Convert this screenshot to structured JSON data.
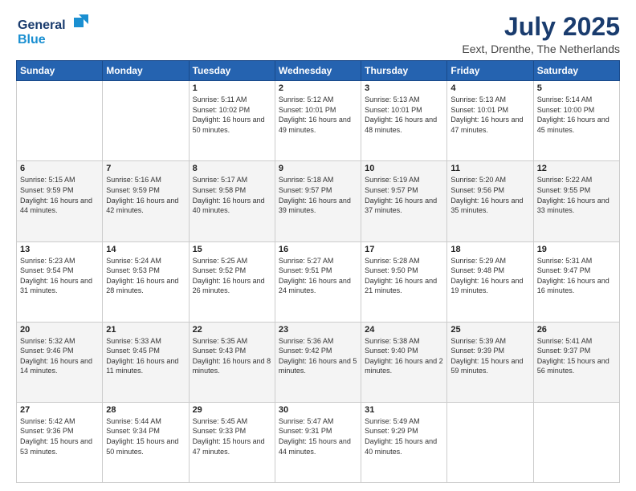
{
  "logo": {
    "line1": "General",
    "line2": "Blue"
  },
  "header": {
    "month": "July 2025",
    "location": "Eext, Drenthe, The Netherlands"
  },
  "weekdays": [
    "Sunday",
    "Monday",
    "Tuesday",
    "Wednesday",
    "Thursday",
    "Friday",
    "Saturday"
  ],
  "weeks": [
    [
      {
        "day": "",
        "sunrise": "",
        "sunset": "",
        "daylight": ""
      },
      {
        "day": "",
        "sunrise": "",
        "sunset": "",
        "daylight": ""
      },
      {
        "day": "1",
        "sunrise": "Sunrise: 5:11 AM",
        "sunset": "Sunset: 10:02 PM",
        "daylight": "Daylight: 16 hours and 50 minutes."
      },
      {
        "day": "2",
        "sunrise": "Sunrise: 5:12 AM",
        "sunset": "Sunset: 10:01 PM",
        "daylight": "Daylight: 16 hours and 49 minutes."
      },
      {
        "day": "3",
        "sunrise": "Sunrise: 5:13 AM",
        "sunset": "Sunset: 10:01 PM",
        "daylight": "Daylight: 16 hours and 48 minutes."
      },
      {
        "day": "4",
        "sunrise": "Sunrise: 5:13 AM",
        "sunset": "Sunset: 10:01 PM",
        "daylight": "Daylight: 16 hours and 47 minutes."
      },
      {
        "day": "5",
        "sunrise": "Sunrise: 5:14 AM",
        "sunset": "Sunset: 10:00 PM",
        "daylight": "Daylight: 16 hours and 45 minutes."
      }
    ],
    [
      {
        "day": "6",
        "sunrise": "Sunrise: 5:15 AM",
        "sunset": "Sunset: 9:59 PM",
        "daylight": "Daylight: 16 hours and 44 minutes."
      },
      {
        "day": "7",
        "sunrise": "Sunrise: 5:16 AM",
        "sunset": "Sunset: 9:59 PM",
        "daylight": "Daylight: 16 hours and 42 minutes."
      },
      {
        "day": "8",
        "sunrise": "Sunrise: 5:17 AM",
        "sunset": "Sunset: 9:58 PM",
        "daylight": "Daylight: 16 hours and 40 minutes."
      },
      {
        "day": "9",
        "sunrise": "Sunrise: 5:18 AM",
        "sunset": "Sunset: 9:57 PM",
        "daylight": "Daylight: 16 hours and 39 minutes."
      },
      {
        "day": "10",
        "sunrise": "Sunrise: 5:19 AM",
        "sunset": "Sunset: 9:57 PM",
        "daylight": "Daylight: 16 hours and 37 minutes."
      },
      {
        "day": "11",
        "sunrise": "Sunrise: 5:20 AM",
        "sunset": "Sunset: 9:56 PM",
        "daylight": "Daylight: 16 hours and 35 minutes."
      },
      {
        "day": "12",
        "sunrise": "Sunrise: 5:22 AM",
        "sunset": "Sunset: 9:55 PM",
        "daylight": "Daylight: 16 hours and 33 minutes."
      }
    ],
    [
      {
        "day": "13",
        "sunrise": "Sunrise: 5:23 AM",
        "sunset": "Sunset: 9:54 PM",
        "daylight": "Daylight: 16 hours and 31 minutes."
      },
      {
        "day": "14",
        "sunrise": "Sunrise: 5:24 AM",
        "sunset": "Sunset: 9:53 PM",
        "daylight": "Daylight: 16 hours and 28 minutes."
      },
      {
        "day": "15",
        "sunrise": "Sunrise: 5:25 AM",
        "sunset": "Sunset: 9:52 PM",
        "daylight": "Daylight: 16 hours and 26 minutes."
      },
      {
        "day": "16",
        "sunrise": "Sunrise: 5:27 AM",
        "sunset": "Sunset: 9:51 PM",
        "daylight": "Daylight: 16 hours and 24 minutes."
      },
      {
        "day": "17",
        "sunrise": "Sunrise: 5:28 AM",
        "sunset": "Sunset: 9:50 PM",
        "daylight": "Daylight: 16 hours and 21 minutes."
      },
      {
        "day": "18",
        "sunrise": "Sunrise: 5:29 AM",
        "sunset": "Sunset: 9:48 PM",
        "daylight": "Daylight: 16 hours and 19 minutes."
      },
      {
        "day": "19",
        "sunrise": "Sunrise: 5:31 AM",
        "sunset": "Sunset: 9:47 PM",
        "daylight": "Daylight: 16 hours and 16 minutes."
      }
    ],
    [
      {
        "day": "20",
        "sunrise": "Sunrise: 5:32 AM",
        "sunset": "Sunset: 9:46 PM",
        "daylight": "Daylight: 16 hours and 14 minutes."
      },
      {
        "day": "21",
        "sunrise": "Sunrise: 5:33 AM",
        "sunset": "Sunset: 9:45 PM",
        "daylight": "Daylight: 16 hours and 11 minutes."
      },
      {
        "day": "22",
        "sunrise": "Sunrise: 5:35 AM",
        "sunset": "Sunset: 9:43 PM",
        "daylight": "Daylight: 16 hours and 8 minutes."
      },
      {
        "day": "23",
        "sunrise": "Sunrise: 5:36 AM",
        "sunset": "Sunset: 9:42 PM",
        "daylight": "Daylight: 16 hours and 5 minutes."
      },
      {
        "day": "24",
        "sunrise": "Sunrise: 5:38 AM",
        "sunset": "Sunset: 9:40 PM",
        "daylight": "Daylight: 16 hours and 2 minutes."
      },
      {
        "day": "25",
        "sunrise": "Sunrise: 5:39 AM",
        "sunset": "Sunset: 9:39 PM",
        "daylight": "Daylight: 15 hours and 59 minutes."
      },
      {
        "day": "26",
        "sunrise": "Sunrise: 5:41 AM",
        "sunset": "Sunset: 9:37 PM",
        "daylight": "Daylight: 15 hours and 56 minutes."
      }
    ],
    [
      {
        "day": "27",
        "sunrise": "Sunrise: 5:42 AM",
        "sunset": "Sunset: 9:36 PM",
        "daylight": "Daylight: 15 hours and 53 minutes."
      },
      {
        "day": "28",
        "sunrise": "Sunrise: 5:44 AM",
        "sunset": "Sunset: 9:34 PM",
        "daylight": "Daylight: 15 hours and 50 minutes."
      },
      {
        "day": "29",
        "sunrise": "Sunrise: 5:45 AM",
        "sunset": "Sunset: 9:33 PM",
        "daylight": "Daylight: 15 hours and 47 minutes."
      },
      {
        "day": "30",
        "sunrise": "Sunrise: 5:47 AM",
        "sunset": "Sunset: 9:31 PM",
        "daylight": "Daylight: 15 hours and 44 minutes."
      },
      {
        "day": "31",
        "sunrise": "Sunrise: 5:49 AM",
        "sunset": "Sunset: 9:29 PM",
        "daylight": "Daylight: 15 hours and 40 minutes."
      },
      {
        "day": "",
        "sunrise": "",
        "sunset": "",
        "daylight": ""
      },
      {
        "day": "",
        "sunrise": "",
        "sunset": "",
        "daylight": ""
      }
    ]
  ]
}
